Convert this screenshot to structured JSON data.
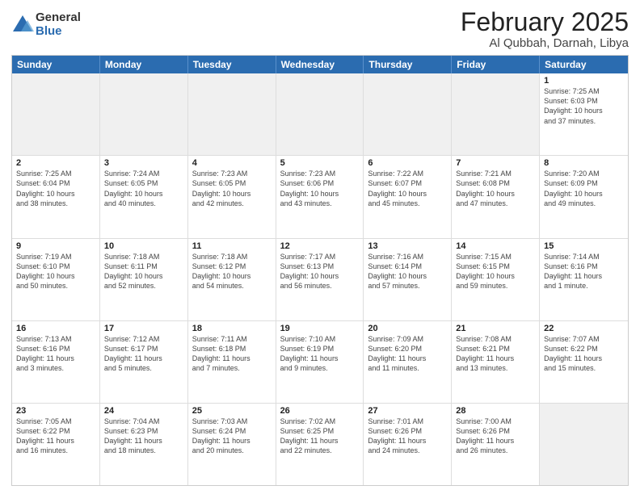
{
  "logo": {
    "general": "General",
    "blue": "Blue"
  },
  "title": "February 2025",
  "subtitle": "Al Qubbah, Darnah, Libya",
  "header_days": [
    "Sunday",
    "Monday",
    "Tuesday",
    "Wednesday",
    "Thursday",
    "Friday",
    "Saturday"
  ],
  "weeks": [
    [
      {
        "day": "",
        "info": "",
        "shaded": true
      },
      {
        "day": "",
        "info": "",
        "shaded": true
      },
      {
        "day": "",
        "info": "",
        "shaded": true
      },
      {
        "day": "",
        "info": "",
        "shaded": true
      },
      {
        "day": "",
        "info": "",
        "shaded": true
      },
      {
        "day": "",
        "info": "",
        "shaded": true
      },
      {
        "day": "1",
        "info": "Sunrise: 7:25 AM\nSunset: 6:03 PM\nDaylight: 10 hours\nand 37 minutes."
      }
    ],
    [
      {
        "day": "2",
        "info": "Sunrise: 7:25 AM\nSunset: 6:04 PM\nDaylight: 10 hours\nand 38 minutes."
      },
      {
        "day": "3",
        "info": "Sunrise: 7:24 AM\nSunset: 6:05 PM\nDaylight: 10 hours\nand 40 minutes."
      },
      {
        "day": "4",
        "info": "Sunrise: 7:23 AM\nSunset: 6:05 PM\nDaylight: 10 hours\nand 42 minutes."
      },
      {
        "day": "5",
        "info": "Sunrise: 7:23 AM\nSunset: 6:06 PM\nDaylight: 10 hours\nand 43 minutes."
      },
      {
        "day": "6",
        "info": "Sunrise: 7:22 AM\nSunset: 6:07 PM\nDaylight: 10 hours\nand 45 minutes."
      },
      {
        "day": "7",
        "info": "Sunrise: 7:21 AM\nSunset: 6:08 PM\nDaylight: 10 hours\nand 47 minutes."
      },
      {
        "day": "8",
        "info": "Sunrise: 7:20 AM\nSunset: 6:09 PM\nDaylight: 10 hours\nand 49 minutes."
      }
    ],
    [
      {
        "day": "9",
        "info": "Sunrise: 7:19 AM\nSunset: 6:10 PM\nDaylight: 10 hours\nand 50 minutes."
      },
      {
        "day": "10",
        "info": "Sunrise: 7:18 AM\nSunset: 6:11 PM\nDaylight: 10 hours\nand 52 minutes."
      },
      {
        "day": "11",
        "info": "Sunrise: 7:18 AM\nSunset: 6:12 PM\nDaylight: 10 hours\nand 54 minutes."
      },
      {
        "day": "12",
        "info": "Sunrise: 7:17 AM\nSunset: 6:13 PM\nDaylight: 10 hours\nand 56 minutes."
      },
      {
        "day": "13",
        "info": "Sunrise: 7:16 AM\nSunset: 6:14 PM\nDaylight: 10 hours\nand 57 minutes."
      },
      {
        "day": "14",
        "info": "Sunrise: 7:15 AM\nSunset: 6:15 PM\nDaylight: 10 hours\nand 59 minutes."
      },
      {
        "day": "15",
        "info": "Sunrise: 7:14 AM\nSunset: 6:16 PM\nDaylight: 11 hours\nand 1 minute."
      }
    ],
    [
      {
        "day": "16",
        "info": "Sunrise: 7:13 AM\nSunset: 6:16 PM\nDaylight: 11 hours\nand 3 minutes."
      },
      {
        "day": "17",
        "info": "Sunrise: 7:12 AM\nSunset: 6:17 PM\nDaylight: 11 hours\nand 5 minutes."
      },
      {
        "day": "18",
        "info": "Sunrise: 7:11 AM\nSunset: 6:18 PM\nDaylight: 11 hours\nand 7 minutes."
      },
      {
        "day": "19",
        "info": "Sunrise: 7:10 AM\nSunset: 6:19 PM\nDaylight: 11 hours\nand 9 minutes."
      },
      {
        "day": "20",
        "info": "Sunrise: 7:09 AM\nSunset: 6:20 PM\nDaylight: 11 hours\nand 11 minutes."
      },
      {
        "day": "21",
        "info": "Sunrise: 7:08 AM\nSunset: 6:21 PM\nDaylight: 11 hours\nand 13 minutes."
      },
      {
        "day": "22",
        "info": "Sunrise: 7:07 AM\nSunset: 6:22 PM\nDaylight: 11 hours\nand 15 minutes."
      }
    ],
    [
      {
        "day": "23",
        "info": "Sunrise: 7:05 AM\nSunset: 6:22 PM\nDaylight: 11 hours\nand 16 minutes."
      },
      {
        "day": "24",
        "info": "Sunrise: 7:04 AM\nSunset: 6:23 PM\nDaylight: 11 hours\nand 18 minutes."
      },
      {
        "day": "25",
        "info": "Sunrise: 7:03 AM\nSunset: 6:24 PM\nDaylight: 11 hours\nand 20 minutes."
      },
      {
        "day": "26",
        "info": "Sunrise: 7:02 AM\nSunset: 6:25 PM\nDaylight: 11 hours\nand 22 minutes."
      },
      {
        "day": "27",
        "info": "Sunrise: 7:01 AM\nSunset: 6:26 PM\nDaylight: 11 hours\nand 24 minutes."
      },
      {
        "day": "28",
        "info": "Sunrise: 7:00 AM\nSunset: 6:26 PM\nDaylight: 11 hours\nand 26 minutes."
      },
      {
        "day": "",
        "info": "",
        "shaded": true
      }
    ]
  ]
}
